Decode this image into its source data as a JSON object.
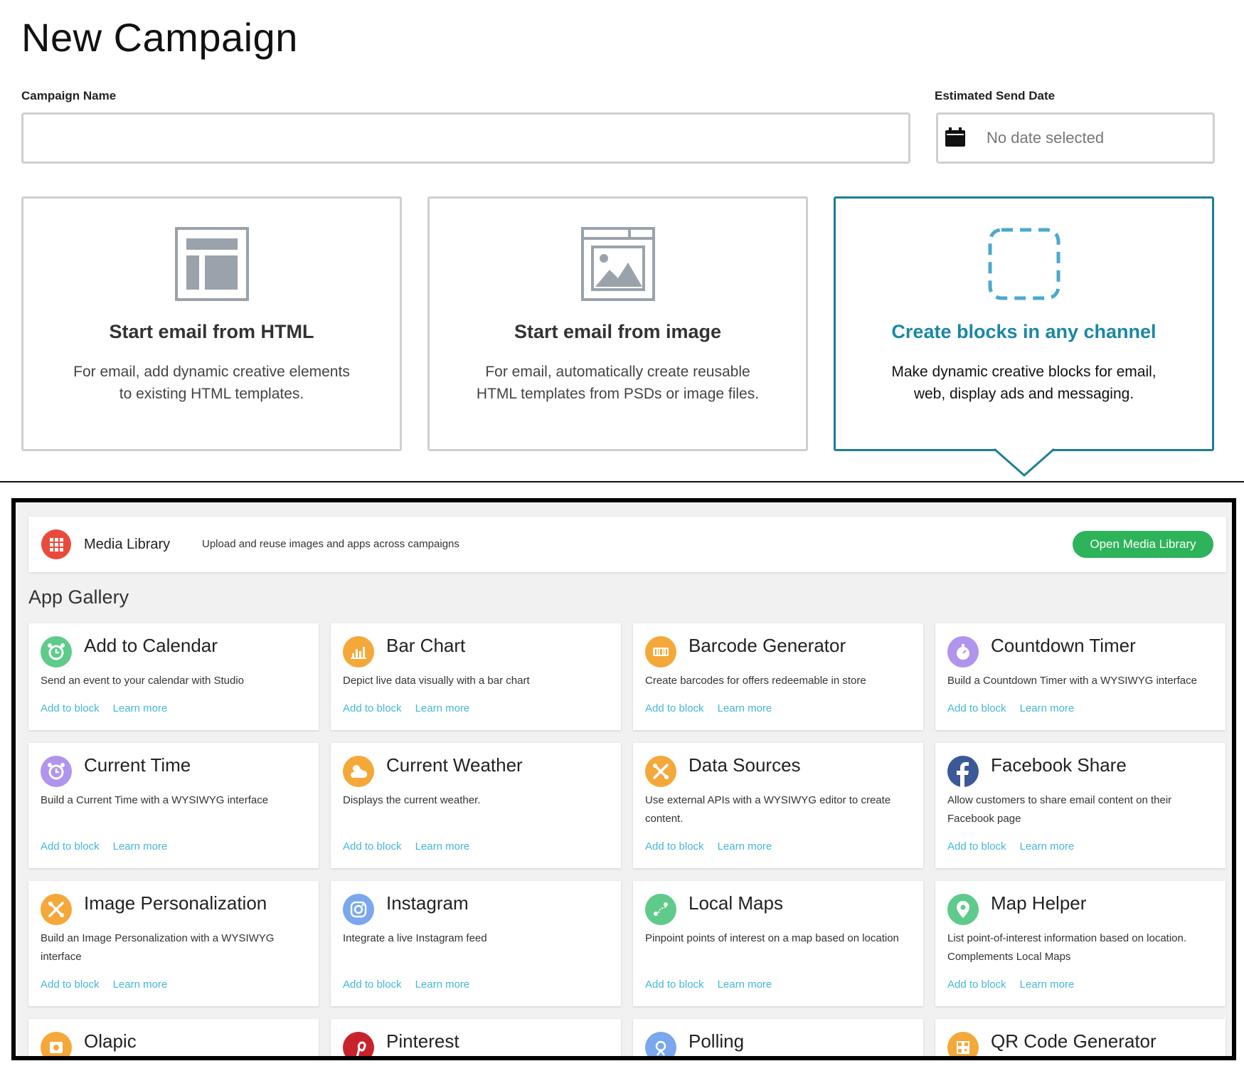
{
  "page": {
    "title": "New Campaign"
  },
  "form": {
    "campaign_name_label": "Campaign Name",
    "campaign_name_value": "",
    "send_date_label": "Estimated Send Date",
    "send_date_value": "No date selected"
  },
  "options": [
    {
      "title": "Start email from HTML",
      "description": "For email, add dynamic creative elements to existing HTML templates.",
      "icon": "html-template-icon",
      "selected": false
    },
    {
      "title": "Start email from image",
      "description": "For email, automatically create reusable HTML templates from PSDs or image files.",
      "icon": "image-template-icon",
      "selected": false
    },
    {
      "title": "Create blocks in any channel",
      "description": "Make dynamic creative blocks for email, web, display ads and messaging.",
      "icon": "dashed-block-icon",
      "selected": true
    }
  ],
  "media_library": {
    "title": "Media Library",
    "description": "Upload and reuse images and apps across campaigns",
    "button": "Open Media Library",
    "icon": "grid-icon",
    "color": "#e84b3c"
  },
  "gallery": {
    "title": "App Gallery",
    "link_add": "Add to block",
    "link_learn": "Learn more",
    "apps": [
      {
        "name": "Add to Calendar",
        "description": "Send an event to your calendar with Studio",
        "icon": "alarm-clock-icon",
        "color": "#5ecb8a"
      },
      {
        "name": "Bar Chart",
        "description": "Depict live data visually with a bar chart",
        "icon": "bar-chart-icon",
        "color": "#f5a83a"
      },
      {
        "name": "Barcode Generator",
        "description": "Create barcodes for offers redeemable in store",
        "icon": "barcode-icon",
        "color": "#f5a83a"
      },
      {
        "name": "Countdown Timer",
        "description": "Build a Countdown Timer with a WYSIWYG interface",
        "icon": "stopwatch-icon",
        "color": "#b094ee"
      },
      {
        "name": "Current Time",
        "description": "Build a Current Time with a WYSIWYG interface",
        "icon": "alarm-clock-icon",
        "color": "#b094ee"
      },
      {
        "name": "Current Weather",
        "description": "Displays the current weather.",
        "icon": "weather-icon",
        "color": "#f5a83a"
      },
      {
        "name": "Data Sources",
        "description": "Use external APIs with a WYSIWYG editor to create content.",
        "icon": "tools-icon",
        "color": "#f5a83a"
      },
      {
        "name": "Facebook Share",
        "description": "Allow customers to share email content on their Facebook page",
        "icon": "facebook-icon",
        "color": "#3b5998"
      },
      {
        "name": "Image Personalization",
        "description": "Build an Image Personalization with a WYSIWYG interface",
        "icon": "tools-icon",
        "color": "#f5a83a"
      },
      {
        "name": "Instagram",
        "description": "Integrate a live Instagram feed",
        "icon": "instagram-icon",
        "color": "#7aa7ee"
      },
      {
        "name": "Local Maps",
        "description": "Pinpoint points of interest on a map based on location",
        "icon": "map-route-icon",
        "color": "#5ecb8a"
      },
      {
        "name": "Map Helper",
        "description": "List point-of-interest information based on location. Complements Local Maps",
        "icon": "map-pin-icon",
        "color": "#5ecb8a"
      },
      {
        "name": "Olapic",
        "description": "",
        "icon": "olapic-icon",
        "color": "#f5a83a"
      },
      {
        "name": "Pinterest",
        "description": "",
        "icon": "pinterest-icon",
        "color": "#c8232c"
      },
      {
        "name": "Polling",
        "description": "",
        "icon": "polling-icon",
        "color": "#7aa7ee"
      },
      {
        "name": "QR Code Generator",
        "description": "",
        "icon": "qr-code-icon",
        "color": "#f5a83a"
      }
    ]
  }
}
